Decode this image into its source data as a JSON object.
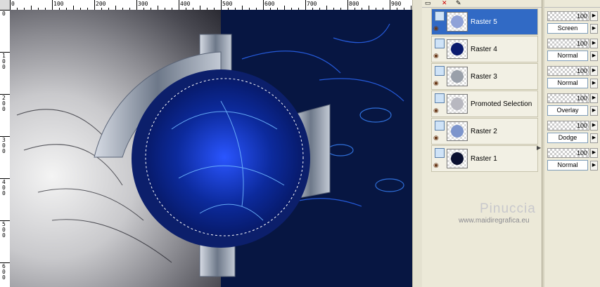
{
  "ruler": {
    "top_labels": [
      "0",
      "100",
      "200",
      "300",
      "400",
      "500",
      "600",
      "700",
      "800",
      "900"
    ],
    "left_labels": [
      "0",
      "100",
      "200",
      "300",
      "400",
      "500",
      "600"
    ]
  },
  "layers": [
    {
      "name": "Raster 5",
      "selected": true,
      "opacity": "100",
      "blend": "Screen"
    },
    {
      "name": "Raster 4",
      "selected": false,
      "opacity": "100",
      "blend": "Normal"
    },
    {
      "name": "Raster 3",
      "selected": false,
      "opacity": "100",
      "blend": "Normal"
    },
    {
      "name": "Promoted Selection",
      "selected": false,
      "opacity": "100",
      "blend": "Overlay"
    },
    {
      "name": "Raster 2",
      "selected": false,
      "opacity": "100",
      "blend": "Dodge"
    },
    {
      "name": "Raster 1",
      "selected": false,
      "opacity": "100",
      "blend": "Normal"
    }
  ],
  "brand": {
    "name": "Pinuccia",
    "url": "www.maidiregrafica.eu"
  },
  "colors": {
    "selected_row": "#316ac5",
    "canvas_blue": "#061236",
    "circle_blue": "#0f2a8a"
  }
}
